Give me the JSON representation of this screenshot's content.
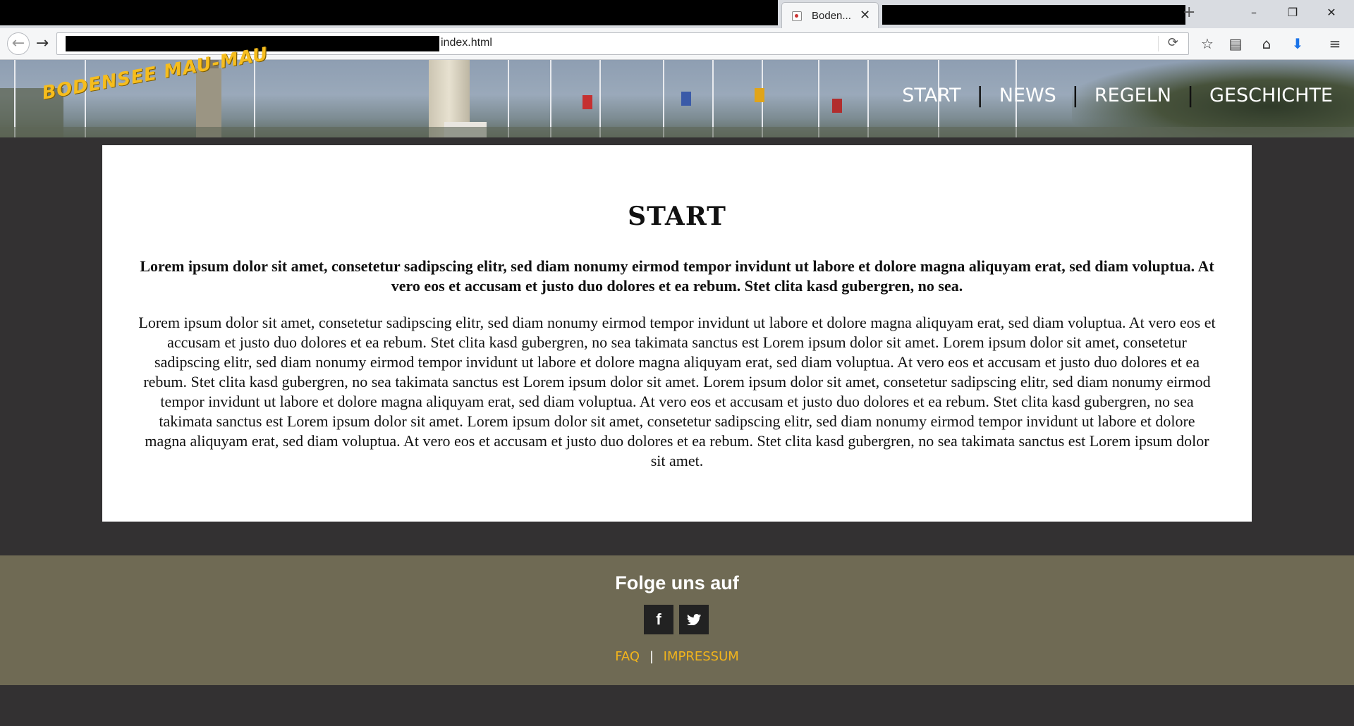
{
  "browser": {
    "tab_title": "Boden...",
    "url_visible": "index.html",
    "window_controls": {
      "minimize": "–",
      "maximize": "❐",
      "close": "✕"
    },
    "tab_close": "✕",
    "new_tab": "+",
    "icons": {
      "back": "←",
      "forward": "→",
      "reload": "⟳",
      "bookmark": "☆",
      "reader": "▤",
      "home": "⌂",
      "download": "⬇",
      "menu": "≡"
    }
  },
  "site": {
    "logo": "BODENSEE MAU-MAU",
    "nav": [
      "START",
      "NEWS",
      "REGELN",
      "GESCHICHTE"
    ],
    "nav_separator": "|"
  },
  "main": {
    "title": "START",
    "lead": "Lorem ipsum dolor sit amet, consetetur sadipscing elitr, sed diam nonumy eirmod tempor invidunt ut labore et dolore magna aliquyam erat, sed diam voluptua. At vero eos et accusam et justo duo dolores et ea rebum. Stet clita kasd gubergren, no sea.",
    "body": "Lorem ipsum dolor sit amet, consetetur sadipscing elitr, sed diam nonumy eirmod tempor invidunt ut labore et dolore magna aliquyam erat, sed diam voluptua. At vero eos et accusam et justo duo dolores et ea rebum. Stet clita kasd gubergren, no sea takimata sanctus est Lorem ipsum dolor sit amet. Lorem ipsum dolor sit amet, consetetur sadipscing elitr, sed diam nonumy eirmod tempor invidunt ut labore et dolore magna aliquyam erat, sed diam voluptua. At vero eos et accusam et justo duo dolores et ea rebum. Stet clita kasd gubergren, no sea takimata sanctus est Lorem ipsum dolor sit amet. Lorem ipsum dolor sit amet, consetetur sadipscing elitr, sed diam nonumy eirmod tempor invidunt ut labore et dolore magna aliquyam erat, sed diam voluptua. At vero eos et accusam et justo duo dolores et ea rebum. Stet clita kasd gubergren, no sea takimata sanctus est Lorem ipsum dolor sit amet. Lorem ipsum dolor sit amet, consetetur sadipscing elitr, sed diam nonumy eirmod tempor invidunt ut labore et dolore magna aliquyam erat, sed diam voluptua. At vero eos et accusam et justo duo dolores et ea rebum. Stet clita kasd gubergren, no sea takimata sanctus est Lorem ipsum dolor sit amet."
  },
  "footer": {
    "title": "Folge uns auf",
    "social": {
      "facebook": "f",
      "twitter": "t"
    },
    "links": [
      "FAQ",
      "IMPRESSUM"
    ],
    "link_separator": "|"
  },
  "colors": {
    "page_bg": "#333132",
    "footer_bg": "#6f6a54",
    "accent": "#f3b51b",
    "content_bg": "#ffffff"
  }
}
